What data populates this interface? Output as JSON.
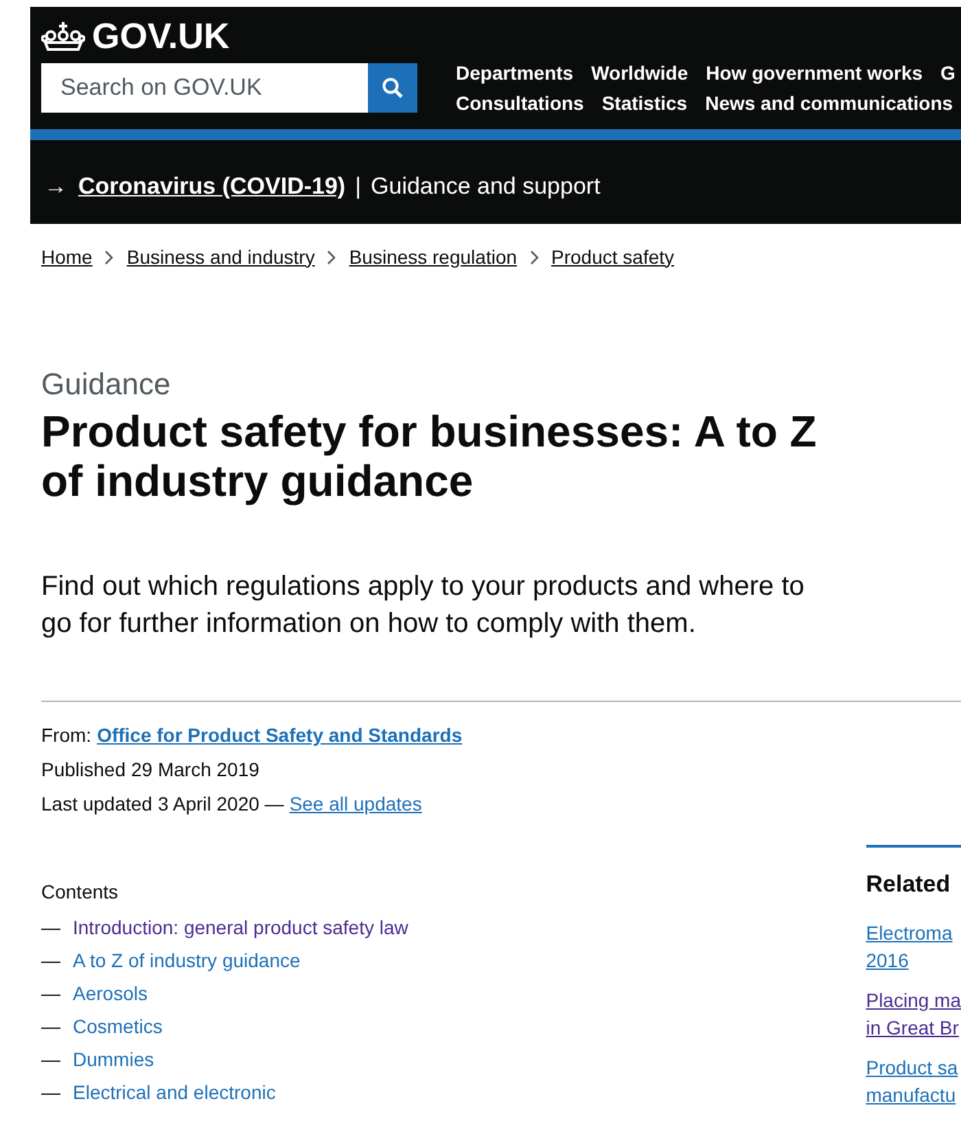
{
  "header": {
    "logo": "GOV.UK",
    "search": {
      "placeholder": "Search on GOV.UK"
    },
    "nav": [
      [
        "Departments",
        "Worldwide",
        "How government works",
        "G"
      ],
      [
        "Consultations",
        "Statistics",
        "News and communications"
      ]
    ]
  },
  "banner": {
    "arrow": "→",
    "link": "Coronavirus (COVID-19)",
    "separator": "|",
    "text": "Guidance and support"
  },
  "breadcrumbs": [
    "Home",
    "Business and industry",
    "Business regulation",
    "Product safety"
  ],
  "caption": "Guidance",
  "title": "Product safety for businesses: A to Z of industry guidance",
  "lead": "Find out which regulations apply to your products and where to go for further information on how to comply with them.",
  "metadata": {
    "from_label": "From:",
    "from_link": "Office for Product Safety and Standards",
    "published_label": "Published",
    "published": "29 March 2019",
    "updated_label": "Last updated",
    "updated": "3 April 2020 —",
    "updates_link": "See all updates"
  },
  "contents": {
    "title": "Contents",
    "items": [
      {
        "dash": "—",
        "label": "Introduction: general product safety law",
        "visited": true
      },
      {
        "dash": "—",
        "label": "A to Z of industry guidance",
        "visited": false
      },
      {
        "dash": "—",
        "label": "Aerosols",
        "visited": false
      },
      {
        "dash": "—",
        "label": "Cosmetics",
        "visited": false
      },
      {
        "dash": "—",
        "label": "Dummies",
        "visited": false
      },
      {
        "dash": "—",
        "label": "Electrical and electronic",
        "visited": false
      }
    ]
  },
  "related": {
    "title": "Related",
    "items": [
      {
        "lines": [
          "Electroma",
          "2016"
        ],
        "visited": false
      },
      {
        "lines": [
          "Placing ma",
          "in Great Br"
        ],
        "visited": true
      },
      {
        "lines": [
          "Product sa",
          "manufactu"
        ],
        "visited": false
      }
    ]
  }
}
